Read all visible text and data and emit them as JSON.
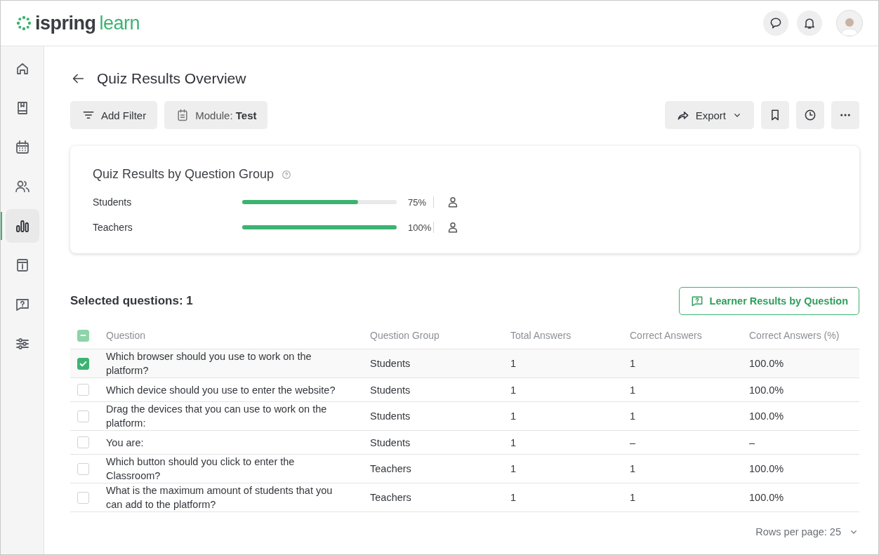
{
  "header": {
    "logo": {
      "brand": "ispring",
      "product": "learn"
    }
  },
  "sidebar": {
    "items": [
      {
        "selected": false
      },
      {
        "selected": false
      },
      {
        "selected": false
      },
      {
        "selected": false
      },
      {
        "selected": true
      },
      {
        "selected": false
      },
      {
        "selected": false
      },
      {
        "selected": false
      }
    ]
  },
  "page": {
    "title": "Quiz Results Overview",
    "filters": [
      {
        "kind": "filter",
        "label": "Add Filter"
      },
      {
        "kind": "module",
        "label": "Module:",
        "value": "Test"
      }
    ],
    "actions": {
      "export": "Export"
    }
  },
  "group_card": {
    "title": "Quiz Results by Question Group",
    "groups": [
      {
        "name": "Students",
        "level": 0.75,
        "reading": "75%"
      },
      {
        "name": "Teachers",
        "level": 1,
        "reading": "100%"
      }
    ]
  },
  "questions": {
    "selected_count": "Selected questions: 1",
    "learner_button": "Learner Results by Question",
    "header_checkbox": {
      "indeterminate": true
    },
    "columns": [
      "Question",
      "Question Group",
      "Total Answers",
      "Correct Answers",
      "Correct Answers (%)"
    ],
    "rows": [
      {
        "selected": true,
        "cells": [
          "Which browser should you use to work on the platform?",
          "Students",
          "1",
          "1",
          "100.0%"
        ]
      },
      {
        "selected": false,
        "cells": [
          "Which device should you use to enter the website?",
          "Students",
          "1",
          "1",
          "100.0%"
        ]
      },
      {
        "selected": false,
        "cells": [
          "Drag the devices that you can use to work on the platform:",
          "Students",
          "1",
          "1",
          "100.0%"
        ]
      },
      {
        "selected": false,
        "cells": [
          "You are:",
          "Students",
          "1",
          "–",
          "–"
        ]
      },
      {
        "selected": false,
        "cells": [
          "Which button should you click to enter the Classroom?",
          "Teachers",
          "1",
          "1",
          "100.0%"
        ]
      },
      {
        "selected": false,
        "cells": [
          "What is the maximum amount of students that you can add to the platform?",
          "Teachers",
          "1",
          "1",
          "100.0%"
        ]
      }
    ],
    "rows_per_page": "Rows per page: 25"
  }
}
